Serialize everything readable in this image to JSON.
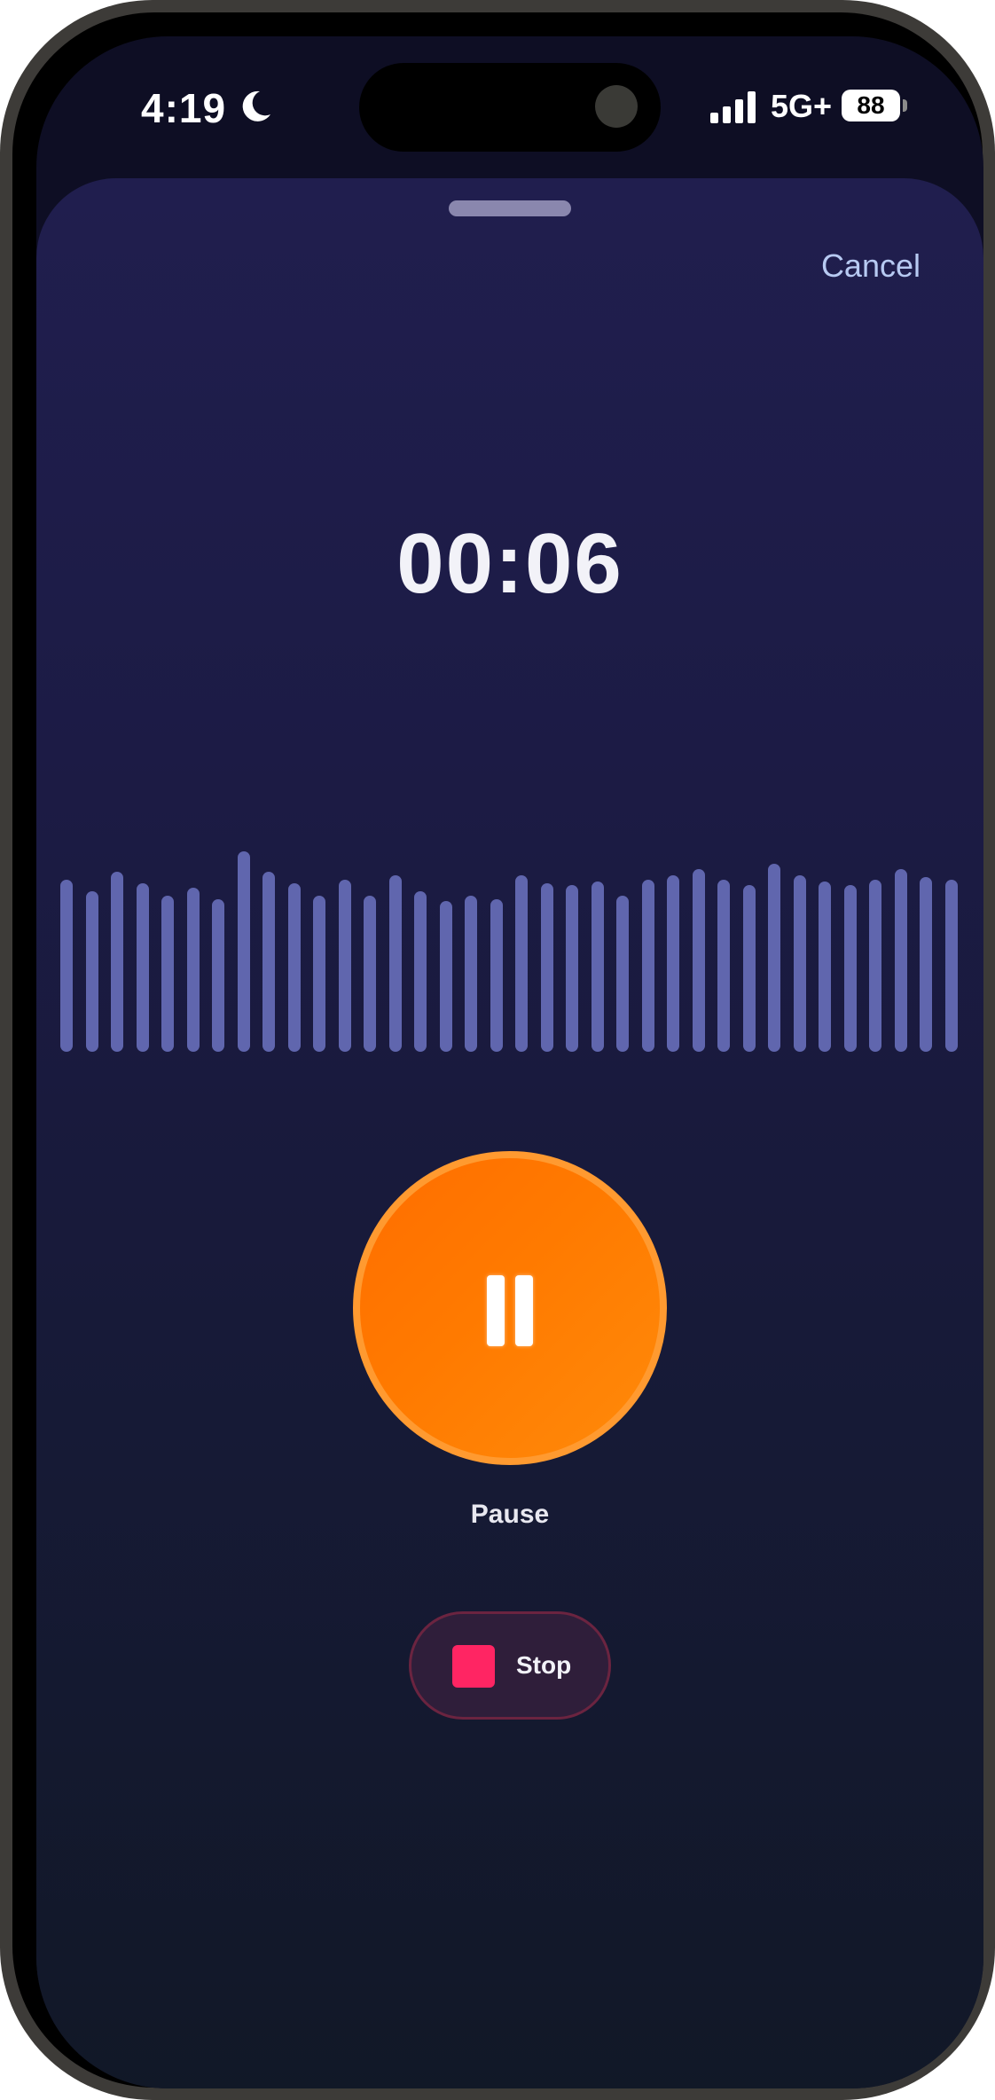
{
  "status_bar": {
    "time": "4:19",
    "network": "5G+",
    "battery": "88",
    "moon_icon": "moon-icon",
    "signal_icon": "cellular-signal-icon"
  },
  "sheet": {
    "cancel_label": "Cancel"
  },
  "recording": {
    "elapsed": "00:06",
    "waveform_levels": [
      0.86,
      0.8,
      0.9,
      0.84,
      0.78,
      0.82,
      0.76,
      1.0,
      0.9,
      0.84,
      0.78,
      0.86,
      0.78,
      0.88,
      0.8,
      0.75,
      0.78,
      0.76,
      0.88,
      0.84,
      0.83,
      0.85,
      0.78,
      0.86,
      0.88,
      0.91,
      0.86,
      0.83,
      0.94,
      0.88,
      0.85,
      0.83,
      0.86,
      0.91,
      0.87,
      0.86
    ]
  },
  "controls": {
    "pause_label": "Pause",
    "stop_label": "Stop"
  },
  "colors": {
    "accent_orange": "#ff7a00",
    "stop_red": "#ff2563",
    "waveform": "#6066ae",
    "cancel_link": "#b7caf2"
  }
}
